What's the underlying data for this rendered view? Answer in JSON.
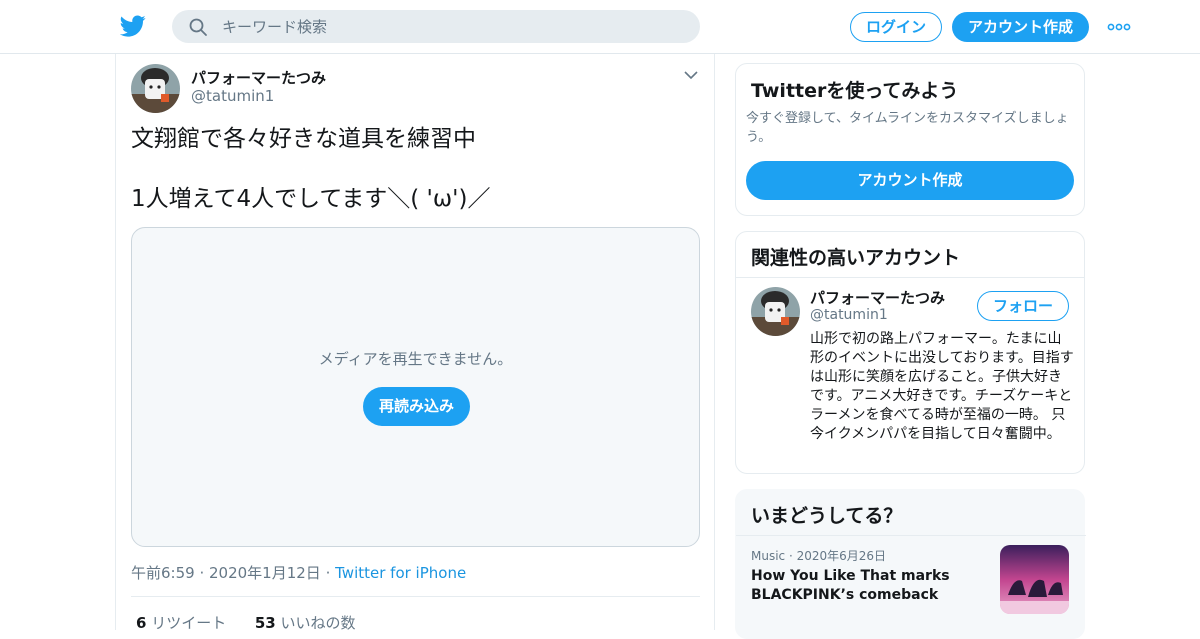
{
  "header": {
    "logo": "twitter-bird-icon",
    "search_placeholder": "キーワード検索",
    "login_label": "ログイン",
    "signup_label": "アカウント作成",
    "more_icon": "more-dots-icon",
    "brand_color": "#1da1f2"
  },
  "tweet": {
    "author_name": "パフォーマーたつみ",
    "author_handle": "@tatumin1",
    "text": "文翔館で各々好きな道具を練習中\n\n1人増えて4人でしてます＼( 'ω')／",
    "media_message": "メディアを再生できません。",
    "media_reload_label": "再読み込み",
    "time": "午前6:59",
    "date": "2020年1月12日",
    "source": "Twitter for iPhone",
    "retweet_count": "6",
    "retweet_label": "リツイート",
    "like_count": "53",
    "like_label": "いいねの数"
  },
  "sidebar": {
    "signup_card": {
      "title": "Twitterを使ってみよう",
      "subtitle": "今すぐ登録して、タイムラインをカスタマイズしましょう。",
      "button_label": "アカウント作成"
    },
    "related_card": {
      "title": "関連性の高いアカウント",
      "accounts": [
        {
          "name": "パフォーマーたつみ",
          "handle": "@tatumin1",
          "follow_label": "フォロー",
          "bio": "山形で初の路上パフォーマー。たまに山形のイベントに出没しております。目指すは山形に笑顔を広げること。子供大好きです。アニメ大好きです。チーズケーキとラーメンを食べてる時が至福の一時。 只今イクメンパパを目指して日々奮闘中。"
        }
      ]
    },
    "trends_card": {
      "title": "いまどうしてる？",
      "items": [
        {
          "category": "Music",
          "date": "2020年6月26日",
          "title": "How You Like That marks BLACKPINK’s comeback"
        }
      ]
    }
  }
}
